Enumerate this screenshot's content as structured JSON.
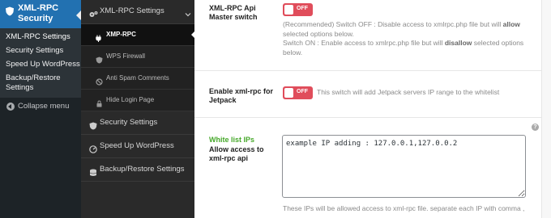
{
  "wp_sidebar": {
    "current_menu": "XML-RPC Security",
    "submenu": [
      "XML-RPC Settings",
      "Security Settings",
      "Speed Up WordPress",
      "Backup/Restore Settings"
    ],
    "collapse_label": "Collapse menu"
  },
  "plugin_nav": {
    "group_xmlrpc": "XML-RPC Settings",
    "sub_xmp_rpc": "XMP-RPC",
    "sub_wps_firewall": "WPS Firewall",
    "sub_anti_spam": "Anti Spam Comments",
    "sub_hide_login": "Hide Login Page",
    "group_security": "Security Settings",
    "group_speed": "Speed Up WordPress",
    "group_backup": "Backup/Restore Settings"
  },
  "content": {
    "master_switch": {
      "label_line1": "XML-RPC Api",
      "label_line2": "Master switch",
      "toggle_state": "OFF",
      "desc1_a": "(Recommended) Switch OFF : Disable access to xmlrpc.php file but will ",
      "desc1_b": "allow",
      "desc1_c": "selected options below.",
      "desc2_a": "Switch ON : Enable access to xmlrpc.php file but will ",
      "desc2_b": "disallow",
      "desc2_c": " selected options",
      "desc2_d": "below."
    },
    "jetpack": {
      "label_line1": "Enable xml-rpc for",
      "label_line2": "Jetpack",
      "toggle_state": "OFF",
      "desc": "This switch will add Jetpack servers IP range to the whitelist"
    },
    "whitelist": {
      "title": "White list IPs",
      "label_line1": "Allow access to",
      "label_line2": "xml-rpc api",
      "value": "example IP adding : 127.0.0.1,127.0.0.2",
      "help": "?",
      "desc": "These IPs will be allowed access to xml-rpc file. separate each IP with comma ,"
    }
  },
  "colors": {
    "wp_accent": "#2271b1",
    "toggle_off": "#e04d5b",
    "whitelist_title": "#46a82a"
  }
}
